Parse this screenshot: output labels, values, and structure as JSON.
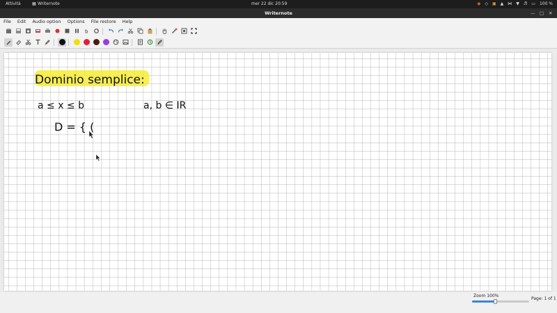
{
  "topbar": {
    "activities": "Attività",
    "app_name": "Writernote",
    "clock": "mer 22 dic  20:59",
    "battery": "100 %"
  },
  "window": {
    "title": "Writernote"
  },
  "menubar": {
    "items": [
      {
        "label": "File"
      },
      {
        "label": "Edit"
      },
      {
        "label": "Audio option"
      },
      {
        "label": "Options"
      },
      {
        "label": "File restore"
      },
      {
        "label": "Help"
      }
    ]
  },
  "toolbar1": {
    "buttons": [
      "new-file-icon",
      "save-icon",
      "save-as-icon",
      "save-local-icon",
      "print-icon",
      "record-icon",
      "stop-icon",
      "pause-icon",
      "text-b-icon",
      "refresh-icon",
      "undo-icon",
      "redo-icon",
      "cut-icon",
      "copy-icon",
      "paste-icon",
      "hand-icon",
      "laser-icon",
      "fit-icon",
      "fullscreen-icon"
    ]
  },
  "toolbar2": {
    "active_tool": "pen",
    "tools": [
      "pen-icon",
      "eraser-icon",
      "scissors-icon",
      "text-tool-icon",
      "highlighter-icon"
    ],
    "colors": [
      {
        "name": "black",
        "hex": "#111111"
      },
      {
        "name": "yellow",
        "hex": "#f0e000"
      },
      {
        "name": "red",
        "hex": "#e0203a"
      },
      {
        "name": "brown",
        "hex": "#4a1c0c"
      },
      {
        "name": "purple",
        "hex": "#9b3ce0"
      }
    ],
    "extras": [
      "palette-icon",
      "image-icon",
      "document-icon",
      "history-icon",
      "pencil-icon"
    ]
  },
  "canvas": {
    "background": "grid",
    "grid_color": "#9a9a9a",
    "highlight_color": "#f6ec35",
    "notes": [
      "Dominio semplice:",
      "a ≤ x ≤ b",
      "a, b ∈ IR",
      "D = { ("
    ]
  },
  "statusbar": {
    "zoom_label": "Zoom 100%",
    "zoom_fraction": 0.4,
    "page_label": "Page: 1 of 1"
  }
}
